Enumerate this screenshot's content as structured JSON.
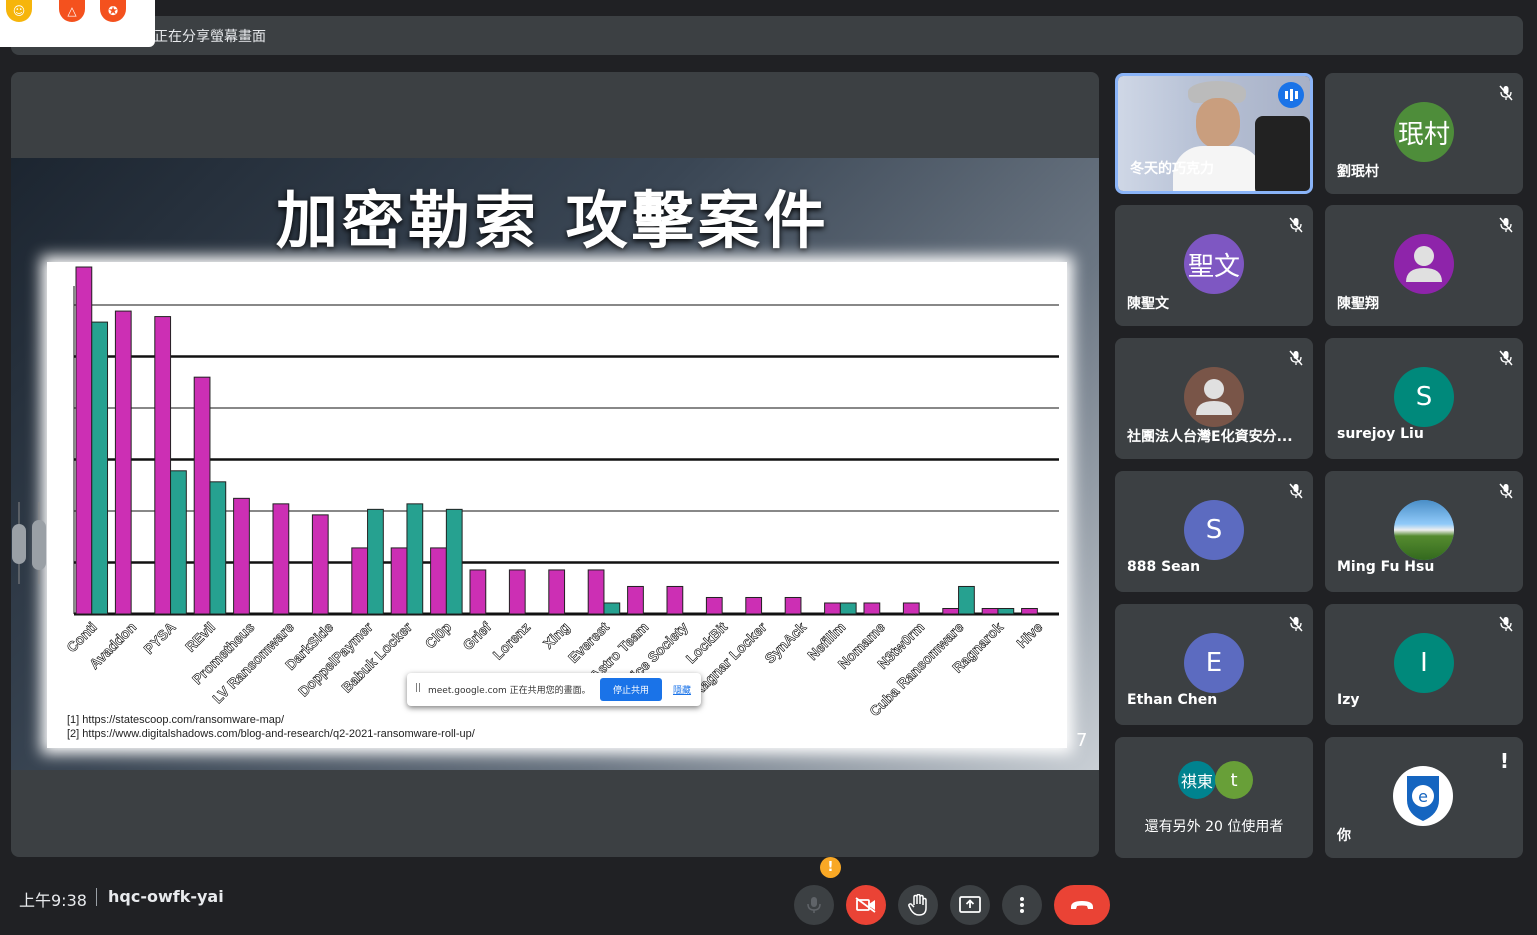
{
  "app": {
    "banner_text": "正在分享螢幕畫面"
  },
  "slide": {
    "title": "加密勒索 攻擊案件",
    "page_number": "7",
    "refs": [
      "[1] https://statescoop.com/ransomware-map/",
      "[2] https://www.digitalshadows.com/blog-and-research/q2-2021-ransomware-roll-up/"
    ]
  },
  "chart_data": {
    "type": "bar",
    "categories": [
      "Conti",
      "Avaddon",
      "PYSA",
      "REvil",
      "Prometheus",
      "LV Ransomware",
      "DarkSide",
      "DoppelPaymer",
      "Babuk Locker",
      "Cl0p",
      "Grief",
      "Lorenz",
      "Xing",
      "Everest",
      "Astro Team",
      "Vice Society",
      "LockBit",
      "Ragnar Locker",
      "SynAck",
      "Nefilim",
      "Nomame",
      "N3tw0rm",
      "Cuba Ransomware",
      "Ragnarok",
      "Hive"
    ],
    "series": [
      {
        "values": [
          63,
          55,
          54,
          43,
          21,
          20,
          18,
          12,
          12,
          12,
          8,
          8,
          8,
          8,
          5,
          5,
          3,
          3,
          3,
          2,
          2,
          2,
          1,
          1,
          1
        ]
      },
      {
        "values": [
          53,
          0,
          26,
          24,
          0,
          0,
          0,
          19,
          20,
          19,
          0,
          0,
          0,
          2,
          0,
          0,
          0,
          0,
          0,
          2,
          0,
          0,
          5,
          1,
          0
        ]
      }
    ],
    "colors": [
      "#cc2fb4",
      "#26a190"
    ],
    "grid": true,
    "ylim": [
      0,
      65
    ]
  },
  "share_bar": {
    "text": "meet.google.com 正在共用您的畫面。",
    "stop": "停止共用",
    "hide": "隱藏"
  },
  "participants": [
    {
      "name": "冬天的巧克力",
      "type": "video",
      "speaking": true
    },
    {
      "name": "劉珉村",
      "initials": "珉村",
      "color": "#4e8d3a"
    },
    {
      "name": "陳聖文",
      "initials": "聖文",
      "color": "#7e57c2"
    },
    {
      "name": "陳聖翔",
      "initials": "",
      "color": "#8e24aa"
    },
    {
      "name": "社團法人台灣E化資安分...",
      "initials": "",
      "color": "#795548"
    },
    {
      "name": "surejoy Liu",
      "initials": "S",
      "color": "#00897b"
    },
    {
      "name": "888 Sean",
      "initials": "S",
      "color": "#5c6bc0"
    },
    {
      "name": "Ming Fu Hsu",
      "initials": "",
      "color": "#4a8ec7"
    },
    {
      "name": "Ethan Chen",
      "initials": "E",
      "color": "#5c6bc0"
    },
    {
      "name": "Izy",
      "initials": "I",
      "color": "#00897b"
    }
  ],
  "more": {
    "label": "還有另外 20 位使用者",
    "a": "祺東",
    "b": "t"
  },
  "self": {
    "name": "你"
  },
  "bottom": {
    "time": "上午9:38",
    "code": "hqc-owfk-yai",
    "warn": "!"
  }
}
